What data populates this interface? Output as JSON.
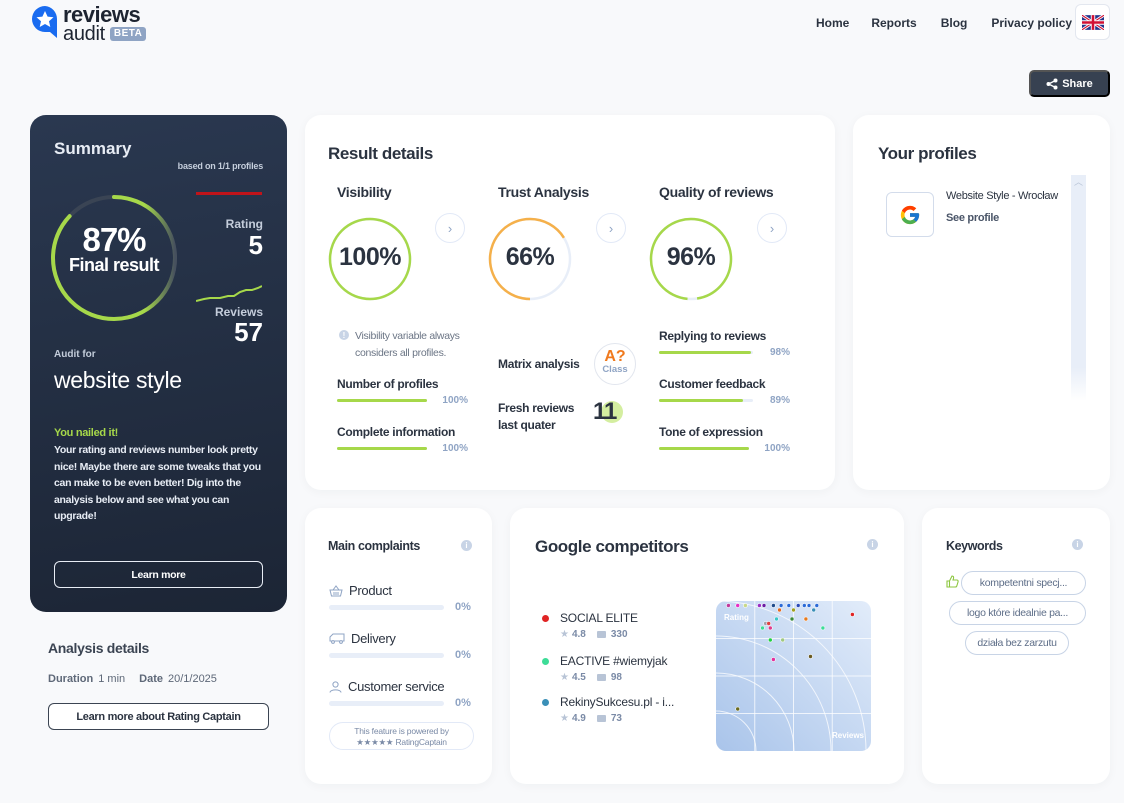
{
  "header": {
    "logo": {
      "line1": "reviews",
      "line2": "audit",
      "badge": "BETA"
    },
    "nav": [
      {
        "label": "Home"
      },
      {
        "label": "Reports"
      },
      {
        "label": "Blog"
      },
      {
        "label": "Privacy policy"
      }
    ],
    "language_icon": "uk-flag-icon",
    "share_label": "Share"
  },
  "summary": {
    "title": "Summary",
    "based_on": "based on 1/1 profiles",
    "final_pct": "87%",
    "final_value": 0.87,
    "final_label": "Final result",
    "rating_label": "Rating",
    "rating_value": "5",
    "reviews_label": "Reviews",
    "reviews_value": "57",
    "audit_for_label": "Audit for",
    "audit_name": "website style",
    "headline": "You nailed it!",
    "description": "Your rating and reviews number look pretty nice! Maybe there are some tweaks that you can make to be even better! Dig into the analysis below and see what you can upgrade!",
    "learn_more": "Learn more",
    "colors": {
      "accent": "#a6d84a",
      "warn": "#c0141a"
    }
  },
  "analysis": {
    "title": "Analysis details",
    "duration_label": "Duration",
    "duration_value": "1 min",
    "date_label": "Date",
    "date_value": "20/1/2025",
    "button": "Learn more about Rating Captain"
  },
  "result_details": {
    "title": "Result details",
    "visibility": {
      "title": "Visibility",
      "pct": "100%",
      "value": 1.0,
      "color": "#a6d84a",
      "note": "Visibility variable always considers all profiles.",
      "metrics": [
        {
          "label": "Number of profiles",
          "value": "100%",
          "fraction": 1.0
        },
        {
          "label": "Complete information",
          "value": "100%",
          "fraction": 1.0
        }
      ]
    },
    "trust": {
      "title": "Trust Analysis",
      "pct": "66%",
      "value": 0.66,
      "color": "#f5b04a",
      "matrix_label": "Matrix analysis",
      "class_value": "A?",
      "class_label": "Class",
      "fresh_label_1": "Fresh reviews",
      "fresh_label_2": "last quater",
      "fresh_value": "11"
    },
    "quality": {
      "title": "Quality of reviews",
      "pct": "96%",
      "value": 0.96,
      "color": "#a6d84a",
      "metrics": [
        {
          "label": "Replying to reviews",
          "value": "98%",
          "fraction": 0.98
        },
        {
          "label": "Customer feedback",
          "value": "89%",
          "fraction": 0.89
        },
        {
          "label": "Tone of expression",
          "value": "100%",
          "fraction": 1.0
        }
      ]
    }
  },
  "profiles": {
    "title": "Your profiles",
    "items": [
      {
        "name": "Website Style - Wrocław",
        "link": "See profile",
        "icon": "google-icon"
      }
    ]
  },
  "complaints": {
    "title": "Main complaints",
    "items": [
      {
        "label": "Product",
        "value": "0%",
        "icon": "basket-icon"
      },
      {
        "label": "Delivery",
        "value": "0%",
        "icon": "truck-icon"
      },
      {
        "label": "Customer service",
        "value": "0%",
        "icon": "person-icon"
      }
    ],
    "powered_line1": "This feature is powered by",
    "powered_line2": "★★★★★ RatingCaptain"
  },
  "competitors": {
    "title": "Google competitors",
    "items": [
      {
        "name": "SOCIAL ELITE",
        "rating": "4.8",
        "reviews": "330",
        "color": "#e02424"
      },
      {
        "name": "EACTIVE #wiemyjak",
        "rating": "4.5",
        "reviews": "98",
        "color": "#3ddc97"
      },
      {
        "name": "RekinySukcesu.pl - i...",
        "rating": "4.9",
        "reviews": "73",
        "color": "#3a8fb7"
      }
    ],
    "scatter": {
      "x_label": "Reviews",
      "y_label": "Rating",
      "points": [
        {
          "x": 0.08,
          "y": 0.97,
          "c": "#c0399b"
        },
        {
          "x": 0.14,
          "y": 0.97,
          "c": "#e62ec4"
        },
        {
          "x": 0.19,
          "y": 0.97,
          "c": "#c8d888"
        },
        {
          "x": 0.28,
          "y": 0.97,
          "c": "#9a2ec4"
        },
        {
          "x": 0.31,
          "y": 0.97,
          "c": "#6a1ea4"
        },
        {
          "x": 0.37,
          "y": 0.97,
          "c": "#1e4a8a"
        },
        {
          "x": 0.42,
          "y": 0.97,
          "c": "#2a6ad8"
        },
        {
          "x": 0.47,
          "y": 0.97,
          "c": "#2a6ad8"
        },
        {
          "x": 0.53,
          "y": 0.97,
          "c": "#2a4ab8"
        },
        {
          "x": 0.57,
          "y": 0.97,
          "c": "#2a6ad8"
        },
        {
          "x": 0.6,
          "y": 0.97,
          "c": "#2a6ad8"
        },
        {
          "x": 0.65,
          "y": 0.97,
          "c": "#2a6ad8"
        },
        {
          "x": 0.41,
          "y": 0.94,
          "c": "#e66a1e"
        },
        {
          "x": 0.5,
          "y": 0.94,
          "c": "#a0a020"
        },
        {
          "x": 0.63,
          "y": 0.94,
          "c": "#3a8fb7"
        },
        {
          "x": 0.88,
          "y": 0.91,
          "c": "#e02424"
        },
        {
          "x": 0.39,
          "y": 0.88,
          "c": "#3ac8c8"
        },
        {
          "x": 0.49,
          "y": 0.88,
          "c": "#3a8a3a"
        },
        {
          "x": 0.58,
          "y": 0.88,
          "c": "#e67a1e"
        },
        {
          "x": 0.32,
          "y": 0.85,
          "c": "#a0a0b0"
        },
        {
          "x": 0.34,
          "y": 0.85,
          "c": "#e04040"
        },
        {
          "x": 0.3,
          "y": 0.82,
          "c": "#3ddc97"
        },
        {
          "x": 0.35,
          "y": 0.82,
          "c": "#e03a8a"
        },
        {
          "x": 0.69,
          "y": 0.82,
          "c": "#3ddc97"
        },
        {
          "x": 0.35,
          "y": 0.74,
          "c": "#20d040"
        },
        {
          "x": 0.43,
          "y": 0.74,
          "c": "#a0c880"
        },
        {
          "x": 0.61,
          "y": 0.63,
          "c": "#6a5a20"
        },
        {
          "x": 0.37,
          "y": 0.61,
          "c": "#e62e9a"
        },
        {
          "x": 0.14,
          "y": 0.28,
          "c": "#6a6a20"
        }
      ]
    }
  },
  "keywords": {
    "title": "Keywords",
    "items": [
      {
        "label": "kompetentni specj...",
        "sentiment": "positive"
      },
      {
        "label": "logo które idealnie pa..."
      },
      {
        "label": "działa bez zarzutu"
      }
    ]
  }
}
